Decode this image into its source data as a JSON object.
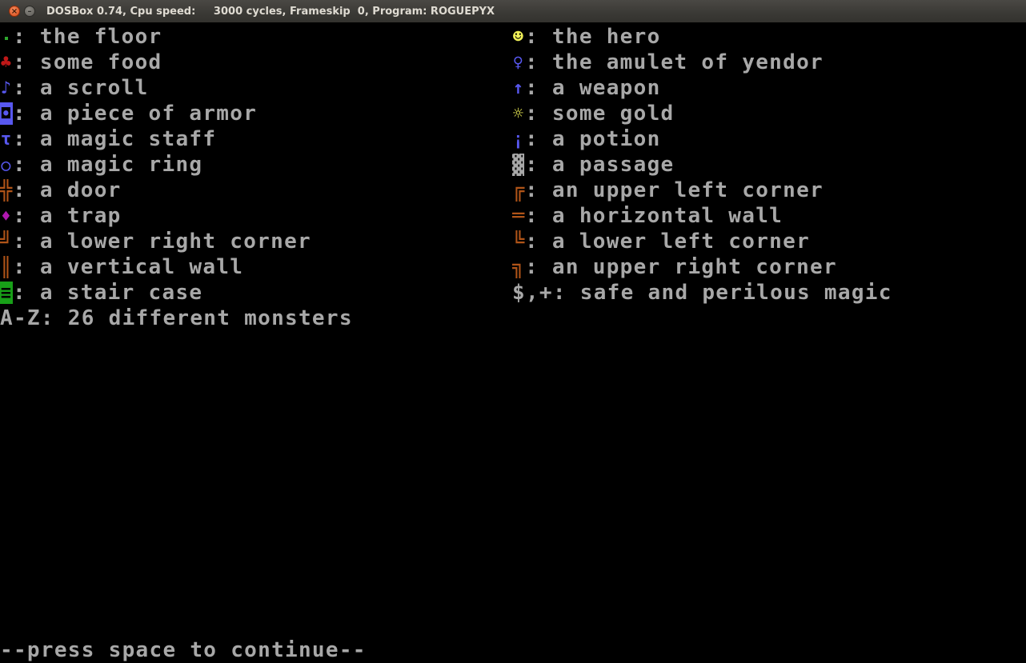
{
  "window": {
    "title": "DOSBox 0.74, Cpu speed:     3000 cycles, Frameskip  0, Program: ROGUEPYX",
    "close_symbol": "×",
    "minimize_symbol": "–"
  },
  "colors": {
    "text": "#a8a8a8",
    "blue": "#5858f0",
    "brown": "#b05418",
    "red": "#c01818",
    "green": "#18a018",
    "yellow": "#f0f058",
    "magenta": "#b018b0"
  },
  "left_column": [
    {
      "icon": "floor-dot",
      "glyph": "",
      "text": ": the floor"
    },
    {
      "icon": "club-food",
      "glyph": "♣",
      "text": ": some food"
    },
    {
      "icon": "note-scroll",
      "glyph": "♪",
      "text": ": a scroll"
    },
    {
      "icon": "armor-block",
      "glyph": "◘",
      "text": ": a piece of armor"
    },
    {
      "icon": "tau-staff",
      "glyph": "τ",
      "text": ": a magic staff"
    },
    {
      "icon": "circle-ring",
      "glyph": "○",
      "text": ": a magic ring"
    },
    {
      "icon": "door-cross",
      "glyph": "╬",
      "text": ": a door"
    },
    {
      "icon": "diamond-trap",
      "glyph": "♦",
      "text": ": a trap"
    },
    {
      "icon": "corner-lower-right",
      "glyph": "╝",
      "text": ": a lower right corner"
    },
    {
      "icon": "double-vertical-wall",
      "glyph": "║",
      "text": ": a vertical wall"
    },
    {
      "icon": "stair-bars",
      "glyph": "≡",
      "text": ": a stair case"
    },
    {
      "icon": "monsters",
      "glyph": "",
      "text": "A-Z: 26 different monsters"
    }
  ],
  "right_column": [
    {
      "icon": "smiley-hero",
      "glyph": "☻",
      "text": ": the hero"
    },
    {
      "icon": "female-amulet",
      "glyph": "♀",
      "text": ": the amulet of yendor"
    },
    {
      "icon": "up-arrow-weapon",
      "glyph": "↑",
      "text": ": a weapon"
    },
    {
      "icon": "sun-gold",
      "glyph": "☼",
      "text": ": some gold"
    },
    {
      "icon": "exclaim-potion",
      "glyph": "¡",
      "text": ": a potion"
    },
    {
      "icon": "shade-passage",
      "glyph": "▓",
      "text": ": a passage"
    },
    {
      "icon": "corner-upper-left",
      "glyph": "╔",
      "text": ": an upper left corner"
    },
    {
      "icon": "double-horizontal-wall",
      "glyph": "═",
      "text": ": a horizontal wall"
    },
    {
      "icon": "corner-lower-left",
      "glyph": "╚",
      "text": ": a lower left corner"
    },
    {
      "icon": "corner-upper-right",
      "glyph": "╗",
      "text": ": an upper right corner"
    },
    {
      "icon": "magic-symbols",
      "glyph": "",
      "text": "$,+: safe and perilous magic"
    }
  ],
  "prompt": "--press space to continue--"
}
